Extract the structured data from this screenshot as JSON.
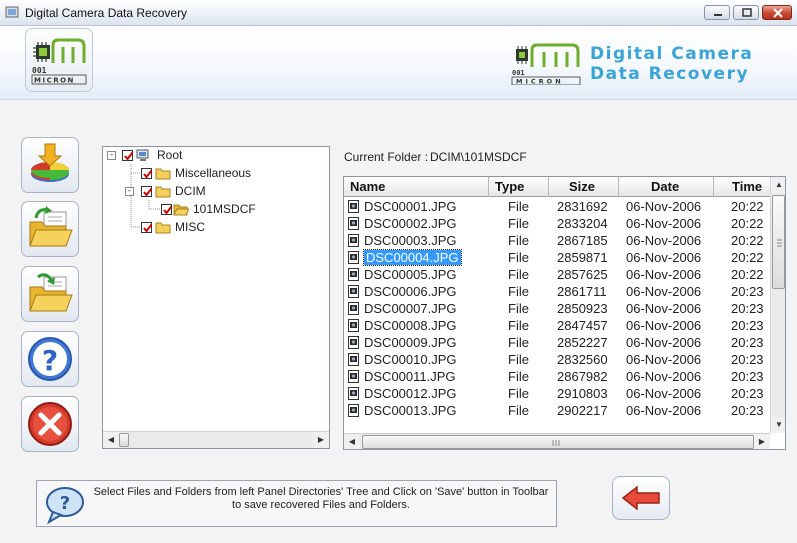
{
  "window": {
    "title": "Digital Camera Data Recovery"
  },
  "header": {
    "brand_line1": "Digital Camera",
    "brand_line2": "Data Recovery",
    "logo_text": "MICRON"
  },
  "toolbar": {
    "buttons": [
      {
        "name": "save-button",
        "icon": "save-pie-download-icon"
      },
      {
        "name": "open-folder-button",
        "icon": "open-folder-icon"
      },
      {
        "name": "open-folder-2-button",
        "icon": "open-folder-arrow-icon"
      },
      {
        "name": "help-button",
        "icon": "question-icon"
      },
      {
        "name": "exit-button",
        "icon": "close-x-icon"
      }
    ]
  },
  "tree": {
    "nodes": [
      {
        "label": "Root",
        "level": 0,
        "expander": "-"
      },
      {
        "label": "Miscellaneous",
        "level": 1,
        "expander": ""
      },
      {
        "label": "DCIM",
        "level": 1,
        "expander": "-"
      },
      {
        "label": "101MSDCF",
        "level": 2,
        "expander": ""
      },
      {
        "label": "MISC",
        "level": 1,
        "expander": ""
      }
    ]
  },
  "current_folder": {
    "label": "Current Folder :",
    "value": "DCIM\\101MSDCF"
  },
  "file_list": {
    "columns": [
      "Name",
      "Type",
      "Size",
      "Date",
      "Time"
    ],
    "rows": [
      {
        "name": "DSC00001.JPG",
        "type": "File",
        "size": "2831692",
        "date": "06-Nov-2006",
        "time": "20:22"
      },
      {
        "name": "DSC00002.JPG",
        "type": "File",
        "size": "2833204",
        "date": "06-Nov-2006",
        "time": "20:22"
      },
      {
        "name": "DSC00003.JPG",
        "type": "File",
        "size": "2867185",
        "date": "06-Nov-2006",
        "time": "20:22"
      },
      {
        "name": "DSC00004.JPG",
        "type": "File",
        "size": "2859871",
        "date": "06-Nov-2006",
        "time": "20:22"
      },
      {
        "name": "DSC00005.JPG",
        "type": "File",
        "size": "2857625",
        "date": "06-Nov-2006",
        "time": "20:22"
      },
      {
        "name": "DSC00006.JPG",
        "type": "File",
        "size": "2861711",
        "date": "06-Nov-2006",
        "time": "20:23"
      },
      {
        "name": "DSC00007.JPG",
        "type": "File",
        "size": "2850923",
        "date": "06-Nov-2006",
        "time": "20:23"
      },
      {
        "name": "DSC00008.JPG",
        "type": "File",
        "size": "2847457",
        "date": "06-Nov-2006",
        "time": "20:23"
      },
      {
        "name": "DSC00009.JPG",
        "type": "File",
        "size": "2852227",
        "date": "06-Nov-2006",
        "time": "20:23"
      },
      {
        "name": "DSC00010.JPG",
        "type": "File",
        "size": "2832560",
        "date": "06-Nov-2006",
        "time": "20:23"
      },
      {
        "name": "DSC00011.JPG",
        "type": "File",
        "size": "2867982",
        "date": "06-Nov-2006",
        "time": "20:23"
      },
      {
        "name": "DSC00012.JPG",
        "type": "File",
        "size": "2910803",
        "date": "06-Nov-2006",
        "time": "20:23"
      },
      {
        "name": "DSC00013.JPG",
        "type": "File",
        "size": "2902217",
        "date": "06-Nov-2006",
        "time": "20:23"
      }
    ],
    "selected_row": "DSC00004.JPG"
  },
  "hint": {
    "text": "Select Files and Folders from left Panel Directories' Tree and Click on 'Save' button in Toolbar to save recovered Files and Folders."
  },
  "colors": {
    "accent": "#3aa4d6",
    "selection": "#3399ff",
    "check": "#cc0000",
    "folder": "#f3cf5b"
  }
}
